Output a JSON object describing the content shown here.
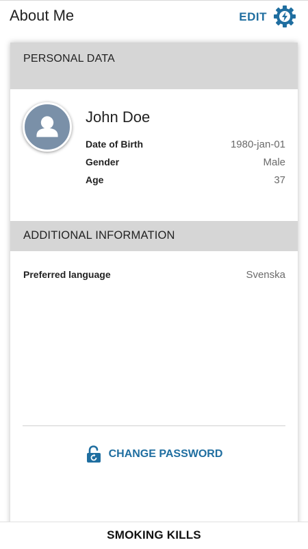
{
  "header": {
    "title": "About Me",
    "edit_label": "EDIT",
    "edit_icon": "gear-bolt-icon"
  },
  "personal": {
    "section_title": "PERSONAL DATA",
    "avatar_icon": "user-avatar-icon",
    "name": "John Doe",
    "fields": [
      {
        "label": "Date of Birth",
        "value": "1980-jan-01"
      },
      {
        "label": "Gender",
        "value": "Male"
      },
      {
        "label": "Age",
        "value": "37"
      }
    ]
  },
  "additional": {
    "section_title": "ADDITIONAL INFORMATION",
    "fields": [
      {
        "label": "Preferred language",
        "value": "Svenska"
      }
    ]
  },
  "actions": {
    "change_password_label": "CHANGE PASSWORD",
    "change_password_icon": "unlock-icon"
  },
  "footer": {
    "text": "SMOKING KILLS"
  },
  "colors": {
    "accent": "#1f6ea0",
    "section_bg": "#d6d6d6",
    "avatar_bg": "#7a90a8"
  }
}
